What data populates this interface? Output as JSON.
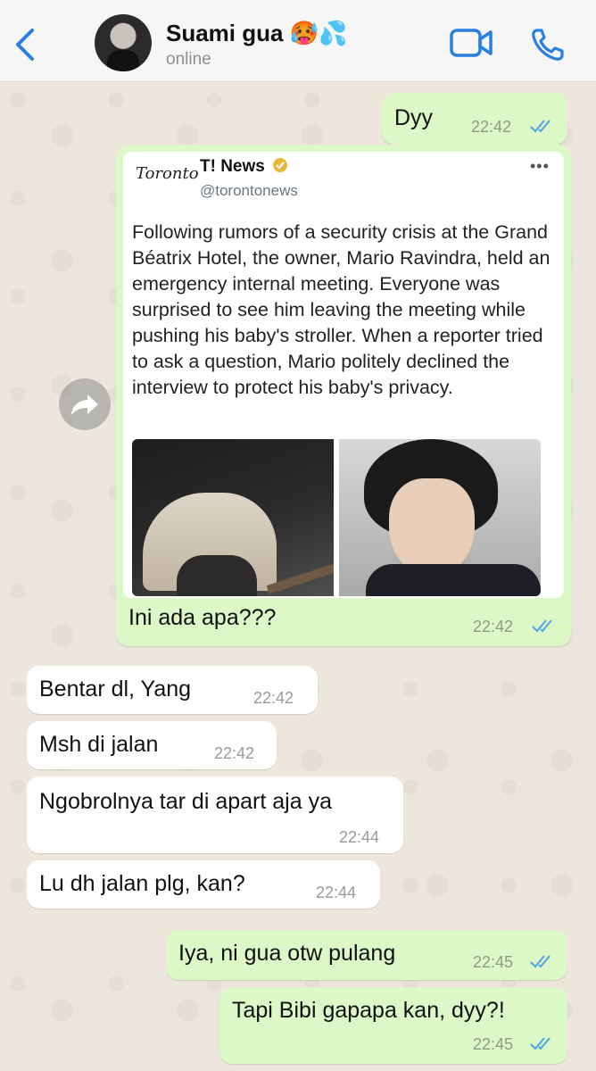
{
  "header": {
    "contact_name": "Suami gua 🥵💦",
    "status": "online"
  },
  "icons": {
    "back": "chevron-left-icon",
    "video": "video-camera-icon",
    "call": "phone-icon",
    "forward": "forward-arrow-icon",
    "ticks": "double-check-icon",
    "verified": "verified-badge-icon"
  },
  "colors": {
    "accent": "#2a7de1",
    "outgoing_bubble": "#dcf8c6",
    "incoming_bubble": "#ffffff",
    "read_ticks": "#4fa3e6"
  },
  "messages": [
    {
      "text": "Dyy",
      "time": "22:42",
      "dir": "out"
    },
    {
      "caption": "Ini ada apa???",
      "time": "22:42",
      "dir": "out"
    },
    {
      "text": "Bentar dl, Yang",
      "time": "22:42",
      "dir": "in"
    },
    {
      "text": "Msh di jalan",
      "time": "22:42",
      "dir": "in"
    },
    {
      "text": "Ngobrolnya tar di apart aja ya",
      "time": "22:44",
      "dir": "in"
    },
    {
      "text": "Lu dh jalan plg, kan?",
      "time": "22:44",
      "dir": "in"
    },
    {
      "text": "Iya, ni gua otw pulang",
      "time": "22:45",
      "dir": "out"
    },
    {
      "text": "Tapi Bibi gapapa kan, dyy?!",
      "time": "22:45",
      "dir": "out"
    }
  ],
  "tweet": {
    "logo": "Toronto",
    "author": "T! News",
    "handle": "@torontonews",
    "more": "•••",
    "body": "Following rumors of a security crisis at the Grand Béatrix Hotel, the owner, Mario Ravindra, held an emergency internal meeting. Everyone was surprised to see him leaving the meeting while pushing his baby's stroller. When a reporter tried to ask a question, Mario politely declined the interview to protect his baby's privacy."
  }
}
